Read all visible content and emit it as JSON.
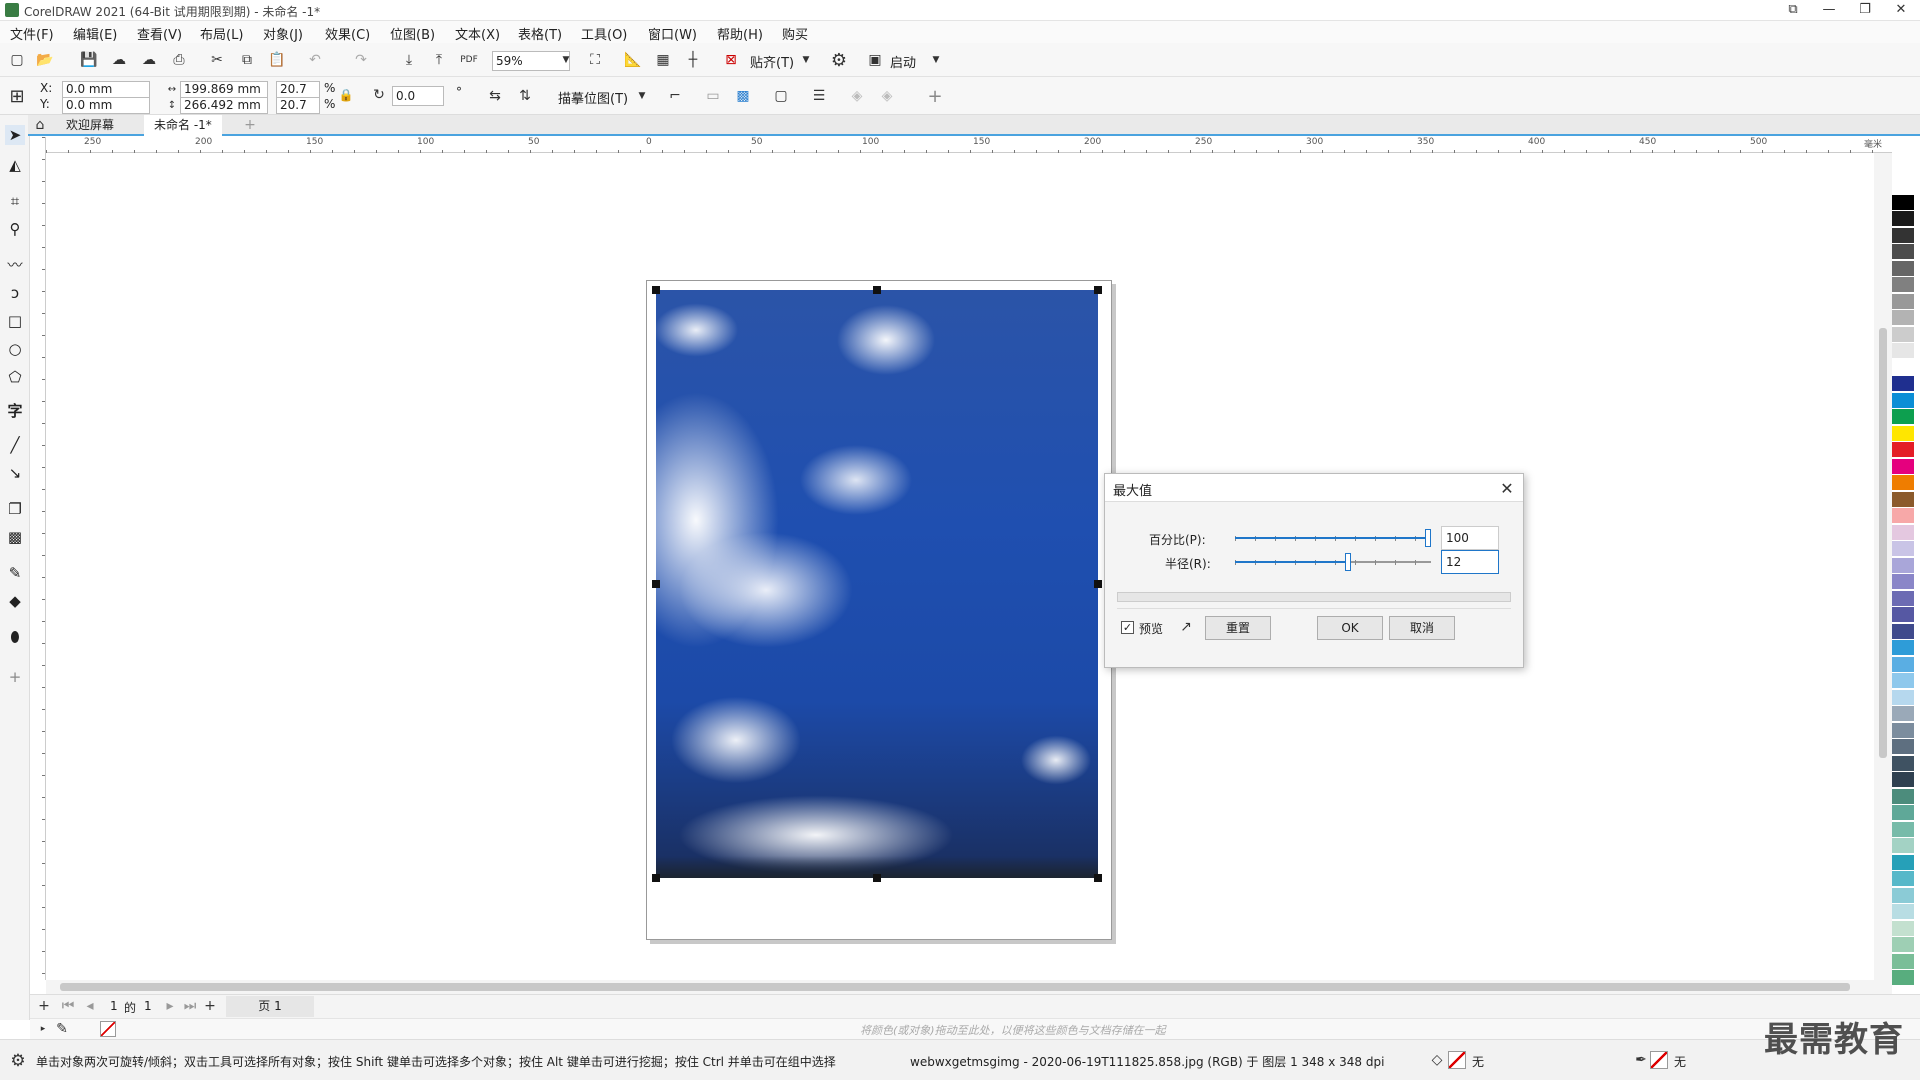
{
  "window": {
    "title": "CorelDRAW 2021 (64-Bit 试用期限到期) - 未命名 -1*"
  },
  "menu": [
    "文件(F)",
    "编辑(E)",
    "查看(V)",
    "布局(L)",
    "对象(J)",
    "效果(C)",
    "位图(B)",
    "文本(X)",
    "表格(T)",
    "工具(O)",
    "窗口(W)",
    "帮助(H)",
    "购买"
  ],
  "toolbar": {
    "zoom": "59%",
    "snap_label": "贴齐(T)",
    "launch_label": "启动"
  },
  "props": {
    "x_label": "X:",
    "y_label": "Y:",
    "x": "0.0 mm",
    "y": "0.0 mm",
    "w": "199.869 mm",
    "h": "266.492 mm",
    "sx": "20.7",
    "sy": "20.7",
    "pct": "%",
    "rot": "0.0",
    "deg": "°",
    "trace_label": "描摹位图(T)"
  },
  "tabs": {
    "welcome": "欢迎屏幕",
    "doc": "未命名 -1*"
  },
  "ruler": {
    "h_ticks": [
      "250",
      "200",
      "150",
      "100",
      "50",
      "0",
      "50",
      "100",
      "150",
      "200",
      "250",
      "300",
      "350",
      "400",
      "450",
      "500"
    ],
    "unit": "毫米"
  },
  "dialog": {
    "title": "最大值",
    "percent_label": "百分比(P):",
    "percent_value": "100",
    "percent_fraction": 1.0,
    "radius_label": "半径(R):",
    "radius_value": "12",
    "radius_fraction": 0.58,
    "preview_label": "预览",
    "reset_label": "重置",
    "ok_label": "OK",
    "cancel_label": "取消"
  },
  "pagenav": {
    "current": "1",
    "of": "的",
    "total": "1",
    "page_tab": "页 1"
  },
  "hint": "将颜色(或对象)拖动至此处，以便将这些颜色与文档存储在一起",
  "status": {
    "tip": "单击对象两次可旋转/倾斜；双击工具可选择所有对象；按住 Shift 键单击可选择多个对象；按住 Alt 键单击可进行挖掘；按住 Ctrl 并单击可在组中选择",
    "info": "webwxgetmsgimg - 2020-06-19T111825.858.jpg (RGB) 于 图层 1 348 x 348 dpi",
    "fill_none": "无",
    "outline_none": "无"
  },
  "watermark": "最需教育",
  "palette": [
    "#ffffff",
    "#000000",
    "#1a1a1a",
    "#333333",
    "#4d4d4d",
    "#666666",
    "#808080",
    "#999999",
    "#b3b3b3",
    "#cccccc",
    "#e6e6e6",
    "#ffffff",
    "#1f2f8f",
    "#0b8ed6",
    "#0d9f4f",
    "#ffe600",
    "#e41e26",
    "#e5007e",
    "#ef7d00",
    "#8b5a2b",
    "#f7a8a8",
    "#e4c8e0",
    "#c9c4e6",
    "#a9a6d9",
    "#8a86c8",
    "#6c6bb3",
    "#5658a3",
    "#3f4a8c",
    "#2e9cd8",
    "#5aaee3",
    "#8ec8ec",
    "#b6d8ee",
    "#9aa9b8",
    "#7c8d9e",
    "#5e6f80",
    "#3f5262",
    "#2f4050",
    "#4c8c7c",
    "#5fa898",
    "#77bba9",
    "#a3d2c4",
    "#26a0b8",
    "#57b8c9",
    "#8bcbd6",
    "#b8dde3",
    "#c3e0cf",
    "#9ecfb4",
    "#7abe98",
    "#58ad7e"
  ]
}
